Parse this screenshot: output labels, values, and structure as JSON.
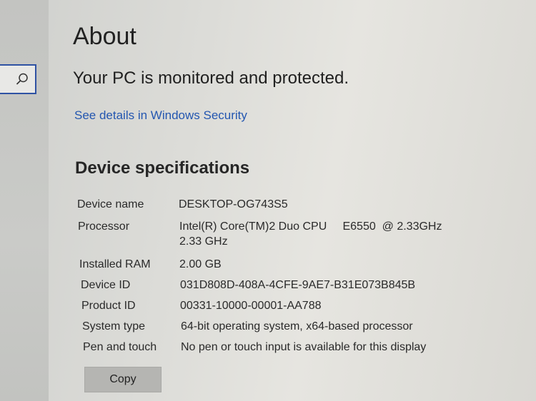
{
  "page": {
    "title": "About",
    "protection_status": "Your PC is monitored and protected.",
    "security_link": "See details in Windows Security"
  },
  "specs": {
    "heading": "Device specifications",
    "rows": [
      {
        "label": "Device name",
        "value": "DESKTOP-OG743S5"
      },
      {
        "label": "Processor",
        "value": "Intel(R) Core(TM)2 Duo CPU     E6550  @ 2.33GHz",
        "value2": "2.33 GHz"
      },
      {
        "label": "Installed RAM",
        "value": "2.00 GB"
      },
      {
        "label": "Device ID",
        "value": "031D808D-408A-4CFE-9AE7-B31E073B845B"
      },
      {
        "label": "Product ID",
        "value": "00331-10000-00001-AA788"
      },
      {
        "label": "System type",
        "value": "64-bit operating system, x64-based processor"
      },
      {
        "label": "Pen and touch",
        "value": "No pen or touch input is available for this display"
      }
    ],
    "copy_label": "Copy"
  },
  "icons": {
    "search": "search-icon"
  }
}
